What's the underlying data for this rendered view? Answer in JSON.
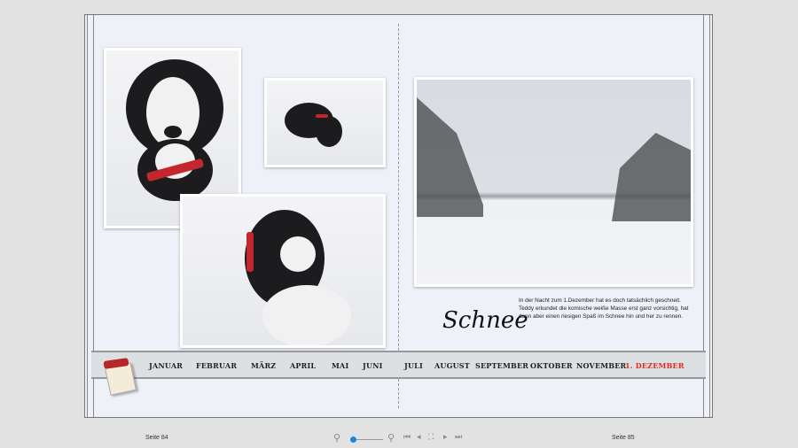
{
  "album": {
    "title": "Schnee",
    "caption": "In der Nacht zum 1.Dezember hat es doch tatsächlich geschneit. Teddy erkundet die komische weiße Masse erst ganz vorsichtig, hat dann aber einen riesigen Spaß im Schnee hin und her zu rennen.",
    "months": [
      "JANUAR",
      "FEBRUAR",
      "MÄRZ",
      "APRIL",
      "MAI",
      "JUNI",
      "JULI",
      "AUGUST",
      "SEPTEMBER",
      "OKTOBER",
      "NOVEMBER",
      "1. DEZEMBER"
    ],
    "active_month": "1. DEZEMBER",
    "accent_color": "#e02a22"
  },
  "footer": {
    "left_page": "Seite 84",
    "right_page": "Seite 85",
    "zoom_level": 0.1,
    "icons": [
      "zoom-out-icon",
      "zoom-in-icon",
      "first-page-icon",
      "previous-page-icon",
      "fit-page-icon",
      "next-page-icon",
      "last-page-icon"
    ]
  }
}
